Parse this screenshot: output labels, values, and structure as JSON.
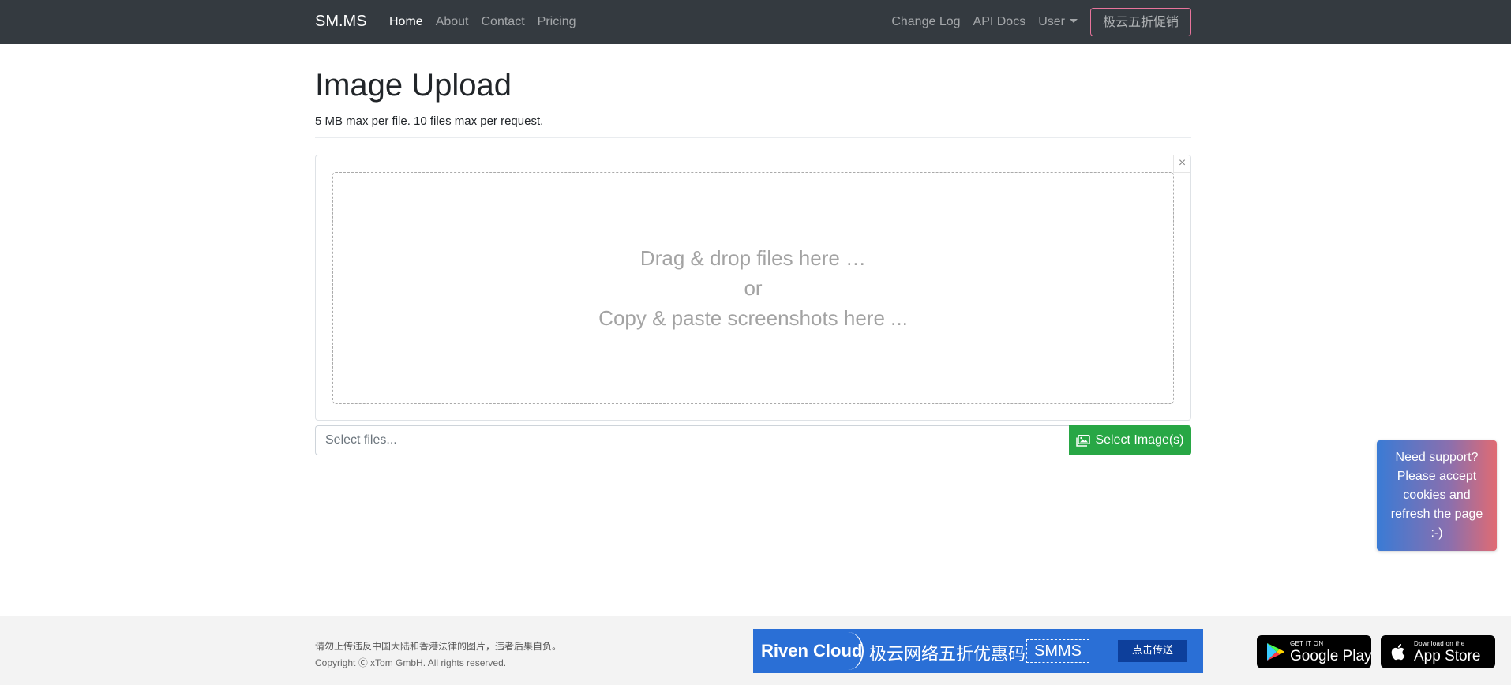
{
  "navbar": {
    "brand": "SM.MS",
    "left_links": [
      {
        "label": "Home",
        "active": true
      },
      {
        "label": "About",
        "active": false
      },
      {
        "label": "Contact",
        "active": false
      },
      {
        "label": "Pricing",
        "active": false
      }
    ],
    "right_links": {
      "changelog": "Change Log",
      "api_docs": "API Docs",
      "user": "User"
    },
    "promo_button": "极云五折促销"
  },
  "main": {
    "title": "Image Upload",
    "subtitle": "5 MB max per file. 10 files max per request.",
    "dropzone": {
      "close_symbol": "×",
      "line1": "Drag & drop files here …",
      "line2": "or",
      "line3": "Copy & paste screenshots here ..."
    },
    "file_input": {
      "placeholder": "Select files..."
    },
    "select_button": "Select Image(s)"
  },
  "support_widget": {
    "text": "Need support? Please accept cookies and refresh the page :-)"
  },
  "footer": {
    "warning": "请勿上传违反中国大陆和香港法律的图片，违者后果自负。",
    "copyright": "Copyright Ⓒ xTom GmbH. All rights reserved.",
    "banner": {
      "brand": "Riven Cloud",
      "text": "极云网络五折优惠码",
      "code": "SMMS",
      "button": "点击传送"
    },
    "google_play": {
      "small": "GET IT ON",
      "big": "Google Play"
    },
    "app_store": {
      "small": "Download on the",
      "big": "App Store"
    }
  },
  "colors": {
    "navbar_bg": "#343a40",
    "select_button": "#28a745",
    "banner_bg": "#2a6fd6",
    "promo_border": "#e8749c"
  },
  "icons": [
    "images-icon",
    "google-play-icon",
    "apple-icon",
    "close-icon",
    "caret-down-icon"
  ]
}
